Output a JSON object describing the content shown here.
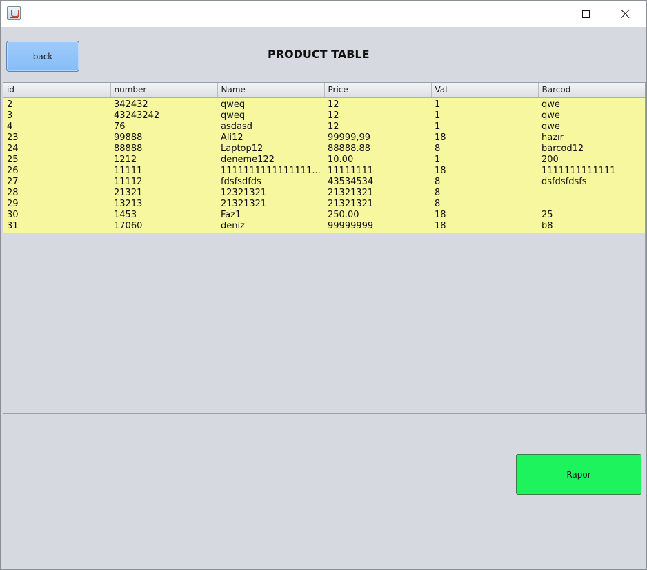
{
  "window": {
    "icon": "java-cup-icon"
  },
  "controls": {
    "back_label": "back",
    "rapor_label": "Rapor"
  },
  "page_title": "PRODUCT TABLE",
  "table": {
    "columns": [
      "id",
      "number",
      "Name",
      "Price",
      "Vat",
      "Barcod"
    ],
    "rows": [
      [
        "2",
        "342432",
        "qweq",
        "12",
        "1",
        "qwe"
      ],
      [
        "3",
        "43243242",
        "qweq",
        "12",
        "1",
        "qwe"
      ],
      [
        "4",
        "76",
        "asdasd",
        "12",
        "1",
        "qwe"
      ],
      [
        "23",
        "99888",
        "Ali12",
        "99999,99",
        "18",
        "hazır"
      ],
      [
        "24",
        "88888",
        "Laptop12",
        "88888.88",
        "8",
        "barcod12"
      ],
      [
        "25",
        "1212",
        "deneme122",
        "10.00",
        "1",
        "200"
      ],
      [
        "26",
        "11111",
        "1111111111111111...",
        "11111111",
        "18",
        "1111111111111"
      ],
      [
        "27",
        "11112",
        "fdsfsdfds",
        "43534534",
        "8",
        "dsfdsfdsfs"
      ],
      [
        "28",
        "21321",
        "12321321",
        "21321321",
        "8",
        ""
      ],
      [
        "29",
        "13213",
        "21321321",
        "21321321",
        "8",
        ""
      ],
      [
        "30",
        "1453",
        "Faz1",
        "250.00",
        "18",
        "25"
      ],
      [
        "31",
        "17060",
        "deniz",
        "99999999",
        "18",
        "b8"
      ]
    ]
  },
  "colors": {
    "row_background": "#f6f79f",
    "back_button": "#8fc3f9",
    "rapor_button": "#1cf35c",
    "panel_background": "#d6d9df"
  }
}
